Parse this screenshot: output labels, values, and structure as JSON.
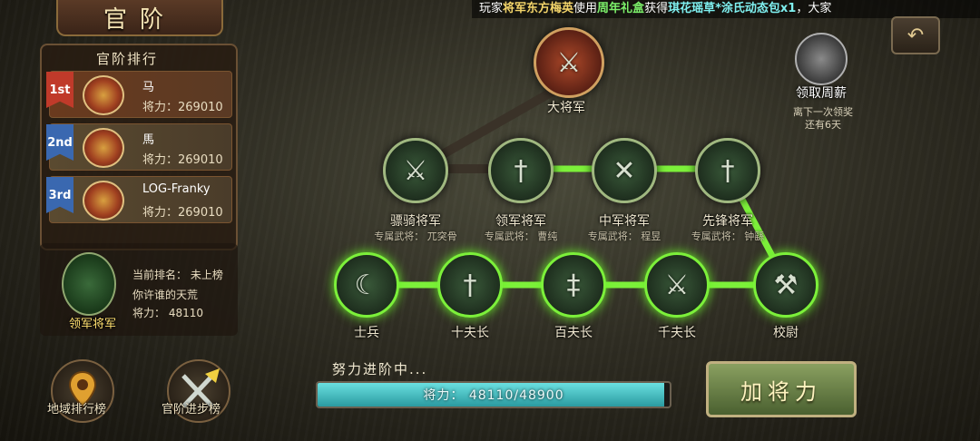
{
  "title": "官阶",
  "ticker": {
    "prefix": "玩家",
    "player": "将军东方梅英",
    "mid1": "使用",
    "item": "周年礼盒",
    "mid2": "获得",
    "reward": "琪花瑶草*涂氏动态包x1",
    "suffix": "，大家"
  },
  "ranking": {
    "header": "官阶排行",
    "rows": [
      {
        "badge": "1st",
        "name": "马",
        "power": "将力：269010"
      },
      {
        "badge": "2nd",
        "name": "馬",
        "power": "将力：269010"
      },
      {
        "badge": "3rd",
        "name": "LOG-Franky",
        "power": "将力：269010"
      }
    ]
  },
  "me": {
    "emblem_label": "领军将军",
    "rank": "当前排名： 未上榜",
    "motto": "你许谁的天荒",
    "power": "将力： 48110"
  },
  "bottom": {
    "area_rank": "地域排行榜",
    "progress_rank": "官阶进步榜"
  },
  "wage": {
    "label": "领取周薪",
    "note_line1": "离下一次领奖",
    "note_line2": "还有6天"
  },
  "tree": {
    "top": {
      "label": "大将军"
    },
    "generals": [
      {
        "label": "骠骑将军",
        "sub": "专属武将： 兀突骨"
      },
      {
        "label": "领军将军",
        "sub": "专属武将： 曹纯"
      },
      {
        "label": "中军将军",
        "sub": "专属武将： 程昱"
      },
      {
        "label": "先锋将军",
        "sub": "专属武将： 钟繇"
      }
    ],
    "ranks": [
      {
        "label": "士兵"
      },
      {
        "label": "十夫长"
      },
      {
        "label": "百夫长"
      },
      {
        "label": "千夫长"
      },
      {
        "label": "校尉"
      }
    ]
  },
  "status": "努力进阶中...",
  "progress": {
    "text": "将力： 48110/48900",
    "current": 48110,
    "max": 48900
  },
  "add_power_button": "加将力",
  "icons": {
    "back": "back-arrow-icon",
    "wage": "treasure-chest-icon",
    "location": "map-pin-icon",
    "swords": "crossed-swords-icon"
  },
  "colors": {
    "active_path": "#7cf03a",
    "progress_fill": "#4ac0c8",
    "rank1_badge": "#c03a2a",
    "rank_badge": "#3a68b0"
  }
}
